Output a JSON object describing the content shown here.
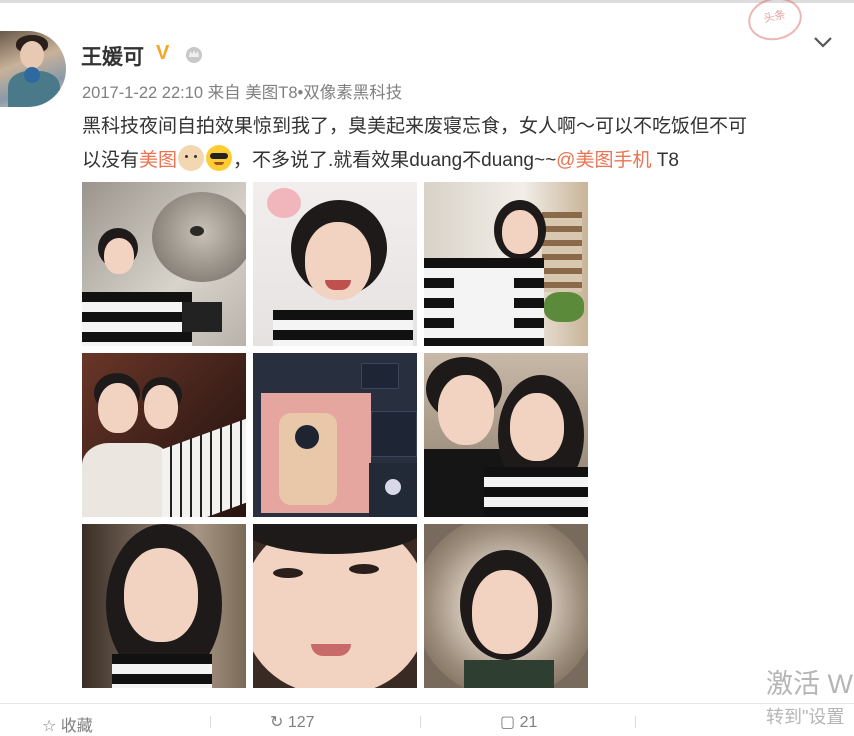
{
  "user": {
    "name": "王媛可",
    "verified_badge": "V",
    "member_icon": "crown-icon"
  },
  "post": {
    "meta": "2017-1-22 22:10 来自 美图T8•双像素黑科技",
    "line1": "黑科技夜间自拍效果惊到我了，臭美起来废寝忘食，女人啊～可以不吃饭但不可",
    "line2_prefix": "以没有",
    "line2_link": "美图",
    "line2_mid": "，不多说了.就看效果duang不duang~~",
    "line2_mention": "@美图手机",
    "line2_suffix": " T8"
  },
  "stamp": "头条",
  "watermark": {
    "line1": "激活 W",
    "line2": "转到\"设置"
  },
  "actions": {
    "favorite": "收藏",
    "repost": "127",
    "comment": "21"
  },
  "colors": {
    "link": "#eb7350",
    "meta": "#808080",
    "badge": "#f5a623"
  }
}
